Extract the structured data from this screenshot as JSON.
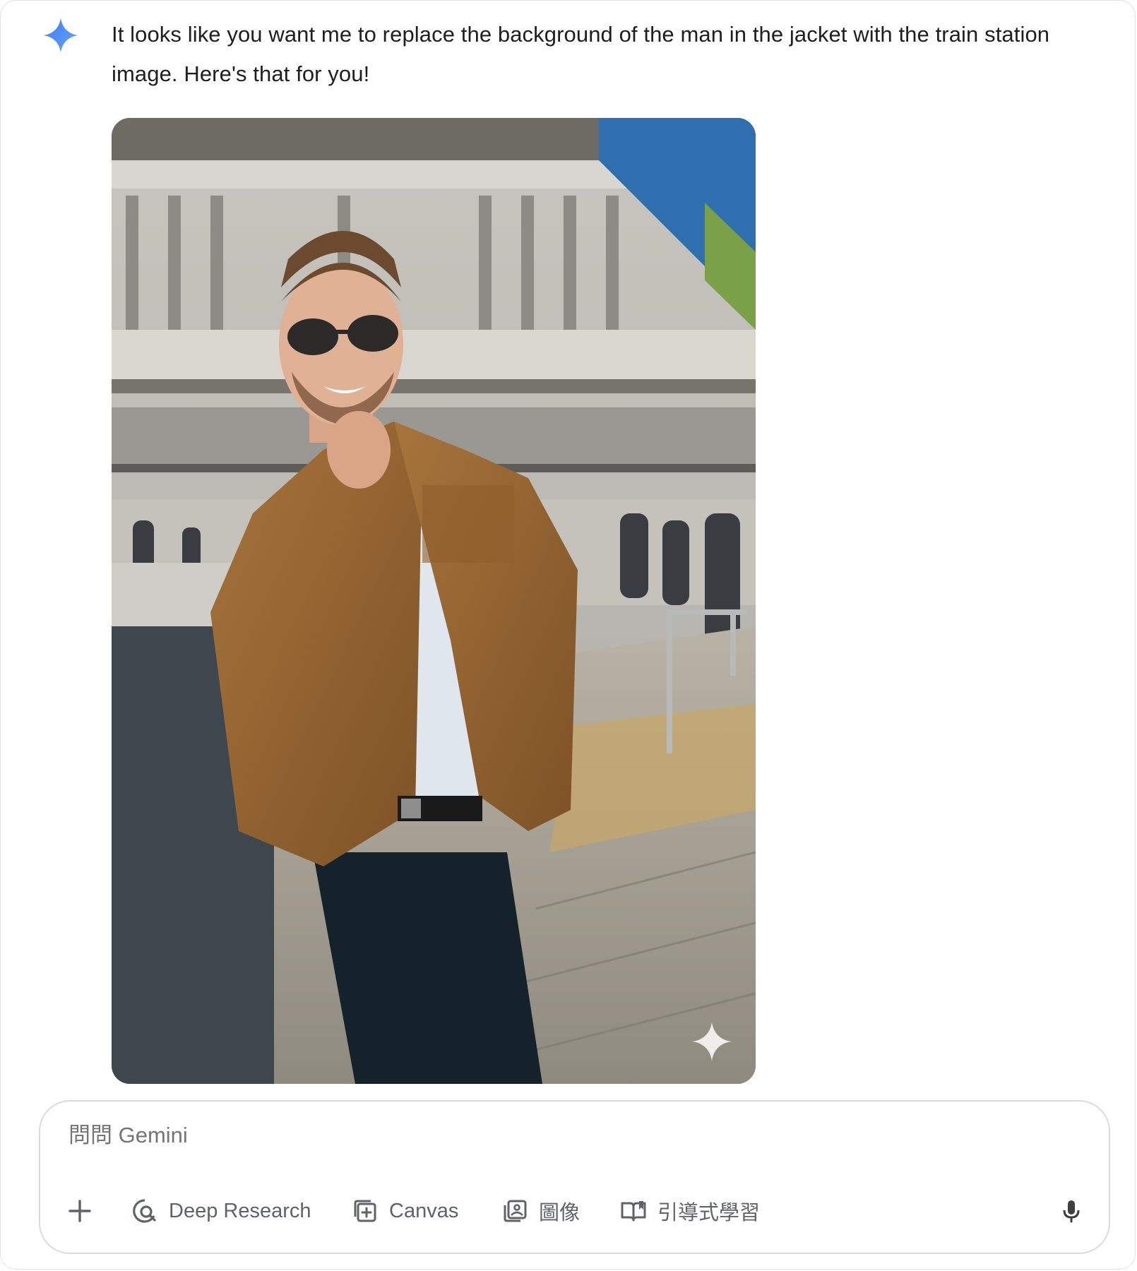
{
  "response": {
    "text": "It looks like you want me to replace the background of the man in the jacket with the train station image. Here's that for you!"
  },
  "colors": {
    "gemini_blue": "#4e8cf0",
    "muted": "#5f6368"
  },
  "composer": {
    "placeholder": "問問 Gemini",
    "tools": {
      "add_icon": "plus-icon",
      "deep_research": "Deep Research",
      "canvas": "Canvas",
      "image": "圖像",
      "guided_learning": "引導式學習",
      "mic_icon": "microphone-icon"
    }
  }
}
